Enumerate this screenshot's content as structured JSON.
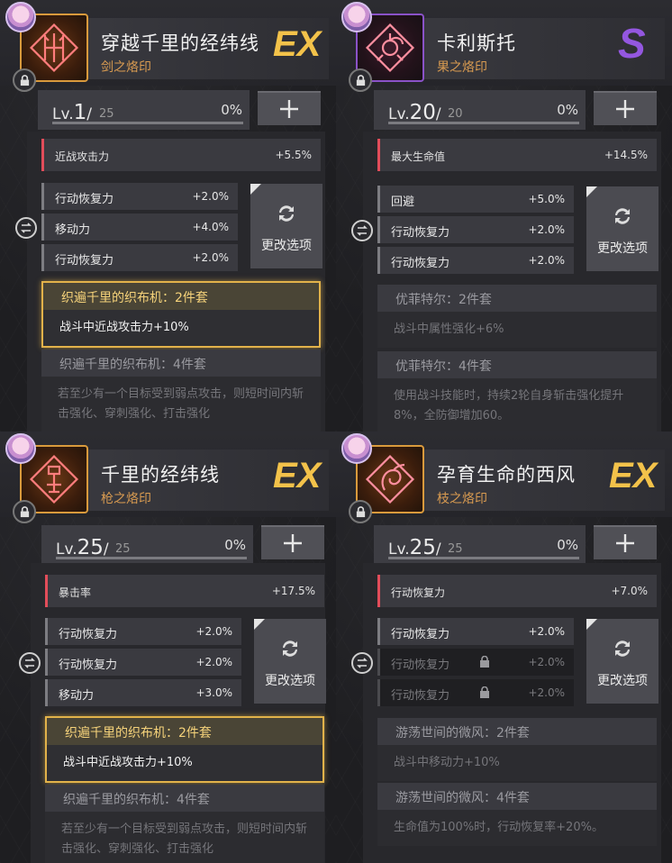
{
  "cards": [
    {
      "title": "穿越千里的经纬线",
      "subtitle": "剑之烙印",
      "rank": "EX",
      "level": "1",
      "max": "25",
      "pct": "0%",
      "fill": 0,
      "main_stat": {
        "name": "近战攻击力",
        "value": "+5.5%"
      },
      "sub_stats": [
        {
          "name": "行动恢复力",
          "value": "+2.0%"
        },
        {
          "name": "移动力",
          "value": "+4.0%"
        },
        {
          "name": "行动恢复力",
          "value": "+2.0%"
        }
      ],
      "change_label": "更改选项",
      "set2": {
        "title": "织遍千里的织布机：2件套",
        "desc": "战斗中近战攻击力+10%"
      },
      "set4": {
        "title": "织遍千里的织布机：4件套",
        "desc": "若至少有一个目标受到弱点攻击，则短时间内斩击强化、穿刺强化、打击强化"
      }
    },
    {
      "title": "卡利斯托",
      "subtitle": "果之烙印",
      "rank": "S",
      "level": "20",
      "max": "20",
      "pct": "0%",
      "fill": 0,
      "main_stat": {
        "name": "最大生命值",
        "value": "+14.5%"
      },
      "sub_stats": [
        {
          "name": "回避",
          "value": "+5.0%"
        },
        {
          "name": "行动恢复力",
          "value": "+2.0%"
        },
        {
          "name": "行动恢复力",
          "value": "+2.0%"
        }
      ],
      "change_label": "更改选项",
      "set2": {
        "title": "优菲特尔：2件套",
        "desc": "战斗中属性强化+6%"
      },
      "set4": {
        "title": "优菲特尔：4件套",
        "desc": "使用战斗技能时，持续2轮自身斩击强化提升8%，全防御增加60。"
      }
    },
    {
      "title": "千里的经纬线",
      "subtitle": "枪之烙印",
      "rank": "EX",
      "level": "25",
      "max": "25",
      "pct": "0%",
      "fill": 0,
      "main_stat": {
        "name": "暴击率",
        "value": "+17.5%"
      },
      "sub_stats": [
        {
          "name": "行动恢复力",
          "value": "+2.0%"
        },
        {
          "name": "行动恢复力",
          "value": "+2.0%"
        },
        {
          "name": "移动力",
          "value": "+3.0%"
        }
      ],
      "change_label": "更改选项",
      "set2": {
        "title": "织遍千里的织布机：2件套",
        "desc": "战斗中近战攻击力+10%"
      },
      "set4": {
        "title": "织遍千里的织布机：4件套",
        "desc": "若至少有一个目标受到弱点攻击，则短时间内斩击强化、穿刺强化、打击强化"
      }
    },
    {
      "title": "孕育生命的西风",
      "subtitle": "枝之烙印",
      "rank": "EX",
      "level": "25",
      "max": "25",
      "pct": "0%",
      "fill": 0,
      "main_stat": {
        "name": "行动恢复力",
        "value": "+7.0%"
      },
      "sub_stats": [
        {
          "name": "行动恢复力",
          "value": "+2.0%"
        },
        {
          "name": "行动恢复力",
          "value": "+2.0%"
        },
        {
          "name": "行动恢复力",
          "value": "+2.0%"
        }
      ],
      "change_label": "更改选项",
      "set2": {
        "title": "游荡世间的微风：2件套",
        "desc": "战斗中移动力+10%"
      },
      "set4": {
        "title": "游荡世间的微风：4件套",
        "desc": "生命值为100%时，行动恢复率+20%。"
      }
    }
  ],
  "colors": {
    "accent_gold": "#e2b24a",
    "main_stat_red": "#e24d5a",
    "subtitle_orange": "#d99b51",
    "rank_s_purple": "#8a52c8"
  },
  "icons": {
    "lock": "lock-icon",
    "plus": "plus-icon",
    "swap": "swap-icon",
    "refresh": "refresh-icon"
  }
}
